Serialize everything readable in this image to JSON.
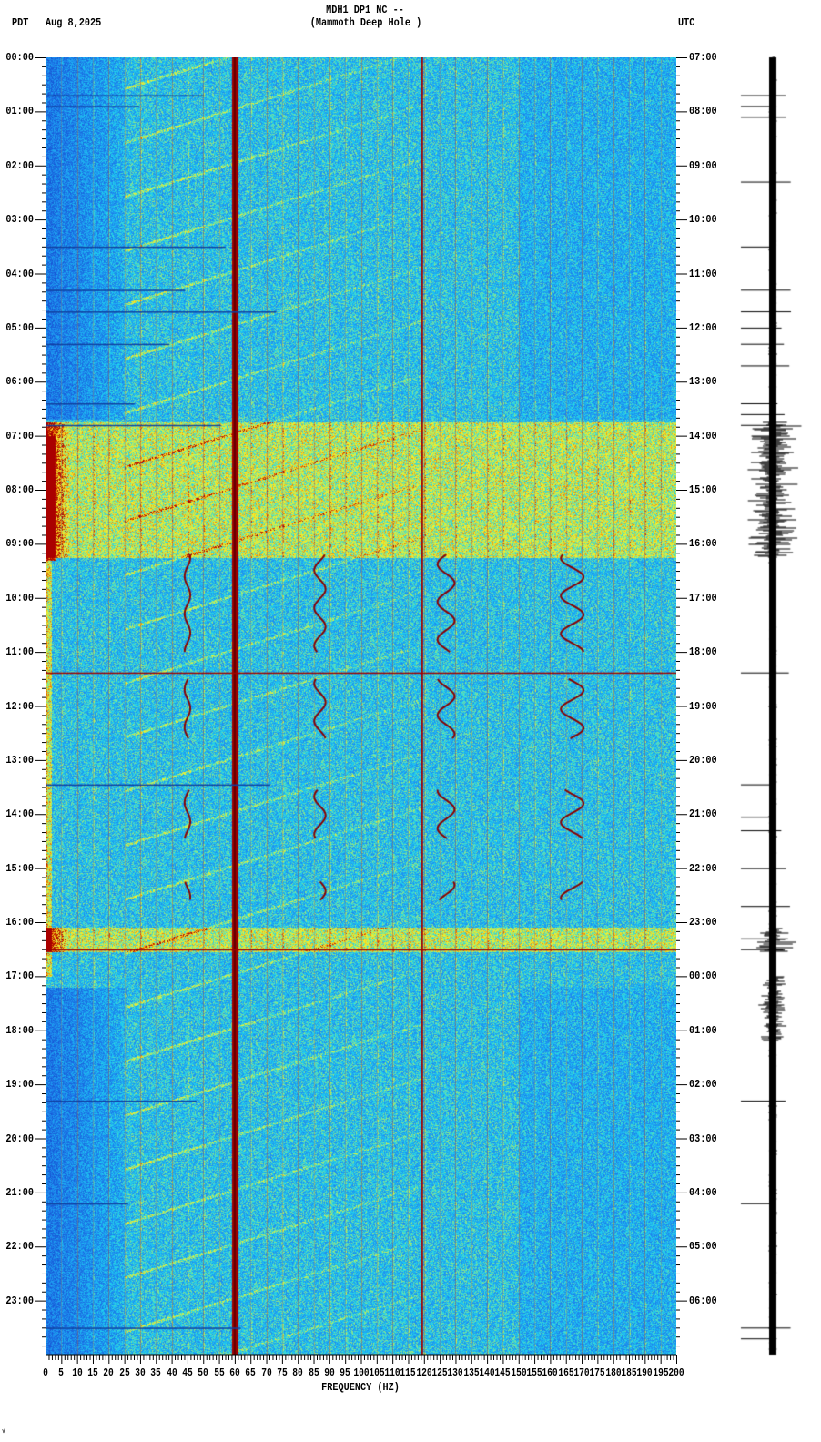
{
  "header": {
    "title_line1": "MDH1 DP1 NC --",
    "title_line2": "(Mammoth Deep Hole )",
    "left_tz": "PDT",
    "date": "Aug 8,2025",
    "right_tz": "UTC"
  },
  "footer_mark": "√",
  "colors": {
    "low": "#1a5fe0",
    "mid": "#20c8f0",
    "high": "#f0f040",
    "peak": "#b00000"
  },
  "chart_data": {
    "type": "heatmap",
    "title": "MDH1 DP1 NC -- (Mammoth Deep Hole )",
    "xlabel": "FREQUENCY (HZ)",
    "ylabel_left": "PDT",
    "ylabel_right": "UTC",
    "xlim": [
      0,
      200
    ],
    "ylim_hours": [
      0,
      24
    ],
    "x_ticks": [
      "0",
      "5",
      "10",
      "15",
      "20",
      "25",
      "30",
      "35",
      "40",
      "45",
      "50",
      "55",
      "60",
      "65",
      "70",
      "75",
      "80",
      "85",
      "90",
      "95",
      "100",
      "105",
      "110",
      "115",
      "120",
      "125",
      "130",
      "135",
      "140",
      "145",
      "150",
      "155",
      "160",
      "165",
      "170",
      "175",
      "180",
      "185",
      "190",
      "195",
      "200"
    ],
    "y_ticks_left": [
      "00:00",
      "01:00",
      "02:00",
      "03:00",
      "04:00",
      "05:00",
      "06:00",
      "07:00",
      "08:00",
      "09:00",
      "10:00",
      "11:00",
      "12:00",
      "13:00",
      "14:00",
      "15:00",
      "16:00",
      "17:00",
      "18:00",
      "19:00",
      "20:00",
      "21:00",
      "22:00",
      "23:00"
    ],
    "y_ticks_right": [
      "07:00",
      "08:00",
      "09:00",
      "10:00",
      "11:00",
      "12:00",
      "13:00",
      "14:00",
      "15:00",
      "16:00",
      "17:00",
      "18:00",
      "19:00",
      "20:00",
      "21:00",
      "22:00",
      "23:00",
      "00:00",
      "01:00",
      "02:00",
      "03:00",
      "04:00",
      "05:00",
      "06:00"
    ],
    "spectral_lines_hz": [
      60,
      120
    ],
    "high_energy_bands_pdt_hours": [
      [
        6.75,
        9.25
      ],
      [
        16.1,
        16.55
      ]
    ],
    "tremor_segments_pdt_hours": [
      [
        9.2,
        11.0
      ],
      [
        11.5,
        12.6
      ],
      [
        13.55,
        14.45
      ],
      [
        15.25,
        15.6
      ]
    ]
  }
}
